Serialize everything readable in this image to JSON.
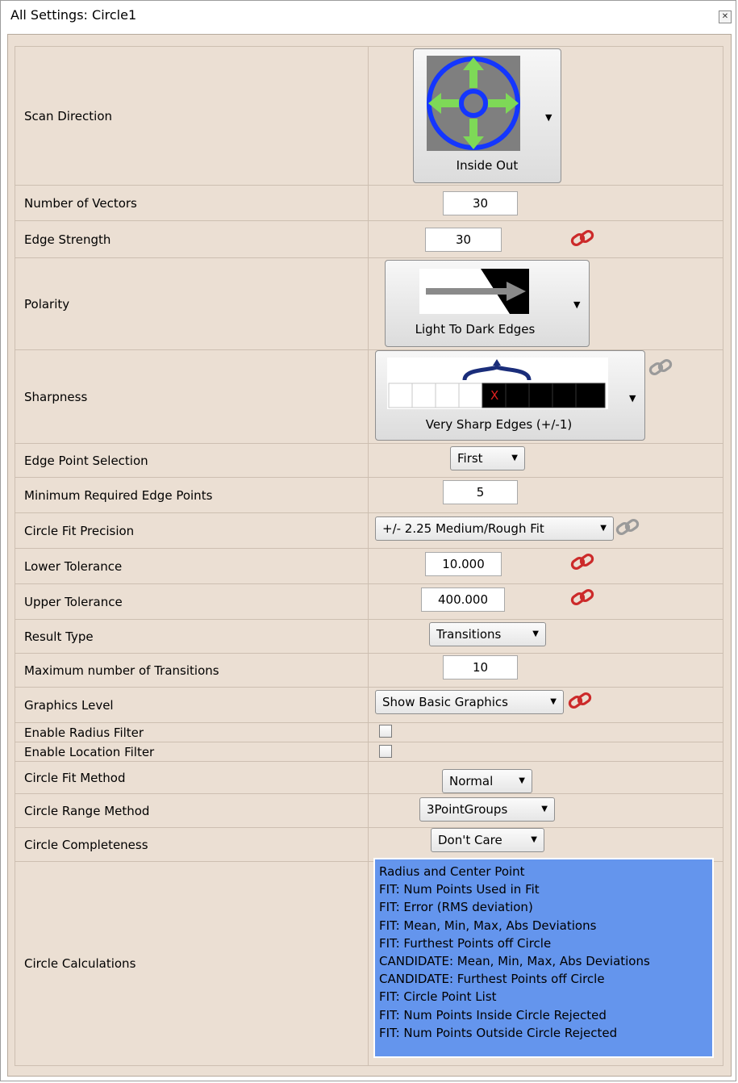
{
  "window": {
    "title": "All Settings: Circle1",
    "close_icon": "close-icon"
  },
  "settings": {
    "scan_direction": {
      "label": "Scan Direction",
      "value": "Inside Out"
    },
    "number_of_vectors": {
      "label": "Number of Vectors",
      "value": "30"
    },
    "edge_strength": {
      "label": "Edge Strength",
      "value": "30"
    },
    "polarity": {
      "label": "Polarity",
      "value": "Light To Dark Edges"
    },
    "sharpness": {
      "label": "Sharpness",
      "value": "Very Sharp Edges (+/-1)",
      "marker": "X"
    },
    "edge_point_selection": {
      "label": "Edge Point Selection",
      "value": "First"
    },
    "min_required_edge_points": {
      "label": "Minimum Required Edge Points",
      "value": "5"
    },
    "circle_fit_precision": {
      "label": "Circle Fit Precision",
      "value": "+/- 2.25 Medium/Rough Fit"
    },
    "lower_tolerance": {
      "label": "Lower Tolerance",
      "value": "10.000"
    },
    "upper_tolerance": {
      "label": "Upper Tolerance",
      "value": "400.000"
    },
    "result_type": {
      "label": "Result Type",
      "value": "Transitions"
    },
    "max_transitions": {
      "label": "Maximum number of Transitions",
      "value": "10"
    },
    "graphics_level": {
      "label": "Graphics Level",
      "value": "Show Basic Graphics"
    },
    "enable_radius_filter": {
      "label": "Enable Radius Filter",
      "checked": false
    },
    "enable_location_filter": {
      "label": "Enable Location Filter",
      "checked": false
    },
    "circle_fit_method": {
      "label": "Circle Fit Method",
      "value": "Normal"
    },
    "circle_range_method": {
      "label": "Circle Range Method",
      "value": "3PointGroups"
    },
    "circle_completeness": {
      "label": "Circle Completeness",
      "value": "Don't Care"
    },
    "circle_calculations": {
      "label": "Circle Calculations",
      "items": [
        "Radius and Center Point",
        "FIT: Num Points Used in Fit",
        "FIT: Error (RMS deviation)",
        "FIT: Mean, Min, Max, Abs Deviations",
        "FIT: Furthest Points off Circle",
        "CANDIDATE: Mean, Min, Max, Abs Deviations",
        "CANDIDATE: Furthest Points off Circle",
        "FIT: Circle Point List",
        "FIT: Num Points Inside Circle Rejected",
        "FIT: Num Points Outside Circle Rejected"
      ]
    }
  },
  "icons": {
    "dropdown": "dropdown-arrow-icon",
    "link": "chain-link-icon",
    "scan": "scan-direction-inside-out-icon",
    "polarity": "light-to-dark-polarity-icon",
    "sharpness": "sharpness-scale-icon"
  },
  "colors": {
    "panel": "#ebdfd3",
    "link": "#cc2a2a",
    "list_bg": "#6495ed",
    "scan_ring": "#1436ff",
    "scan_arrow": "#7ed957"
  }
}
